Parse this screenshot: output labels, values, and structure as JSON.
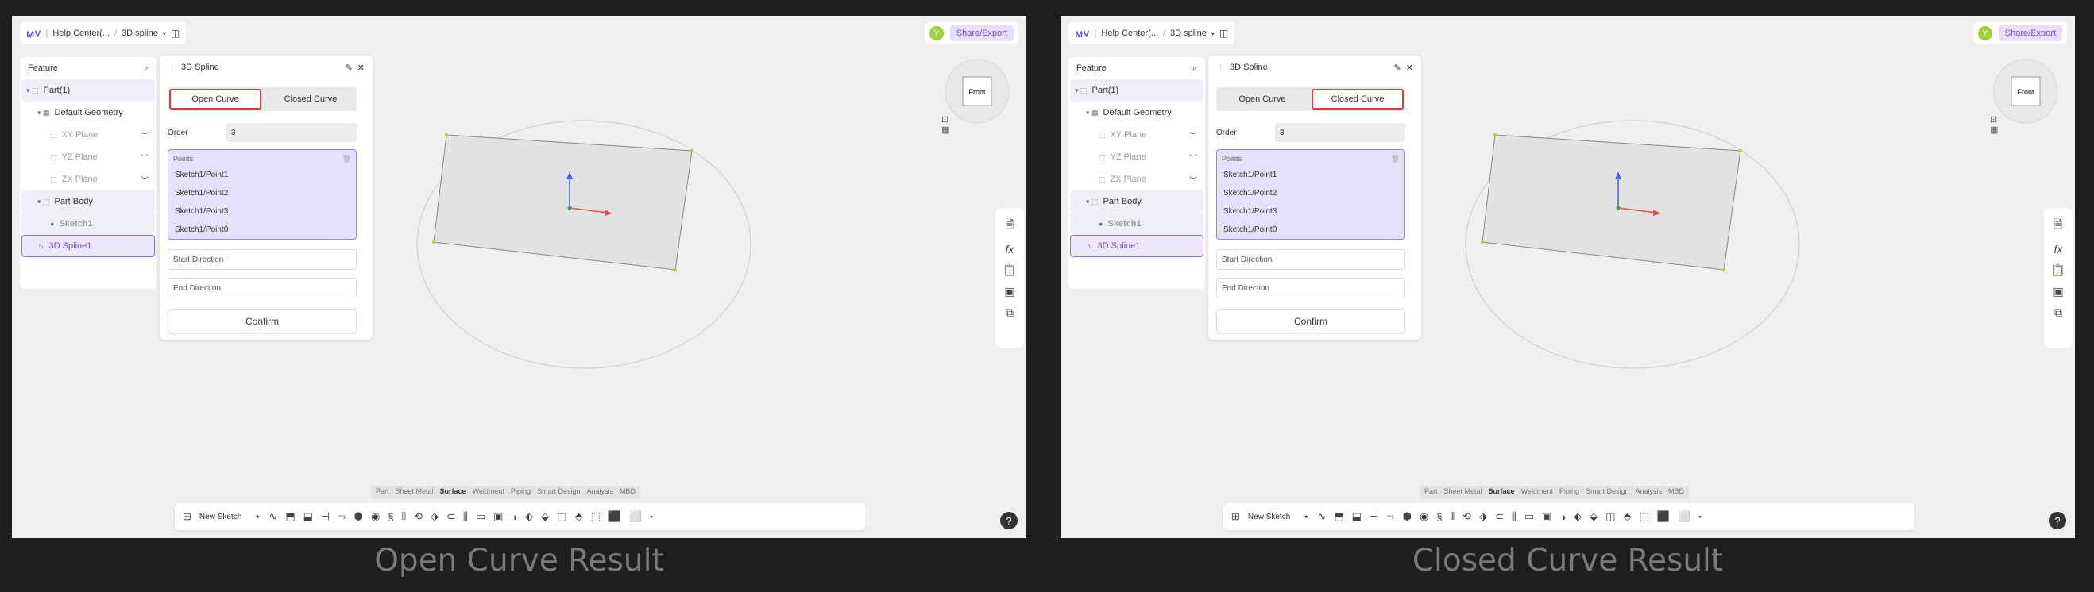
{
  "screens": [
    {
      "caption": "Open Curve Result",
      "active_mode": "open",
      "header": {
        "crumbs": [
          "Help Center(...",
          "3D spline"
        ]
      },
      "share_label": "Share/Export",
      "avatar_letter": "Y",
      "tree": {
        "title": "Feature",
        "items": [
          "Part(1)",
          "Default Geometry",
          "XY Plane",
          "YZ Plane",
          "ZX Plane",
          "Part Body",
          "Sketch1",
          "3D Spline1"
        ]
      },
      "panel": {
        "title": "3D Spline",
        "open_label": "Open Curve",
        "closed_label": "Closed Curve",
        "order_label": "Order",
        "order_value": "3",
        "points_title": "Points",
        "points": [
          "Sketch1/Point1",
          "Sketch1/Point2",
          "Sketch1/Point3",
          "Sketch1/Point0"
        ],
        "start_direction": "Start Direction",
        "end_direction": "End Direction",
        "confirm": "Confirm"
      },
      "nav_label": "Front",
      "tabs": [
        "Part",
        "Sheet Metal",
        "Surface",
        "Weldment",
        "Piping",
        "Smart Design",
        "Analysis",
        "MBD"
      ],
      "active_tab": "Surface",
      "new_sketch": "New Sketch"
    },
    {
      "caption": "Closed Curve Result",
      "active_mode": "closed",
      "header": {
        "crumbs": [
          "Help Center(...",
          "3D spline"
        ]
      },
      "share_label": "Share/Export",
      "avatar_letter": "Y",
      "tree": {
        "title": "Feature",
        "items": [
          "Part(1)",
          "Default Geometry",
          "XY Plane",
          "YZ Plane",
          "ZX Plane",
          "Part Body",
          "Sketch1",
          "3D Spline1"
        ]
      },
      "panel": {
        "title": "3D Spline",
        "open_label": "Open Curve",
        "closed_label": "Closed Curve",
        "order_label": "Order",
        "order_value": "3",
        "points_title": "Points",
        "points": [
          "Sketch1/Point1",
          "Sketch1/Point2",
          "Sketch1/Point3",
          "Sketch1/Point0"
        ],
        "start_direction": "Start Direction",
        "end_direction": "End Direction",
        "confirm": "Confirm"
      },
      "nav_label": "Front",
      "tabs": [
        "Part",
        "Sheet Metal",
        "Surface",
        "Weldment",
        "Piping",
        "Smart Design",
        "Analysis",
        "MBD"
      ],
      "active_tab": "Surface",
      "new_sketch": "New Sketch"
    }
  ],
  "colors": {
    "accent": "#6b4fd6",
    "highlight_border": "#e0393e",
    "selection_bg": "#e7e0fb"
  }
}
